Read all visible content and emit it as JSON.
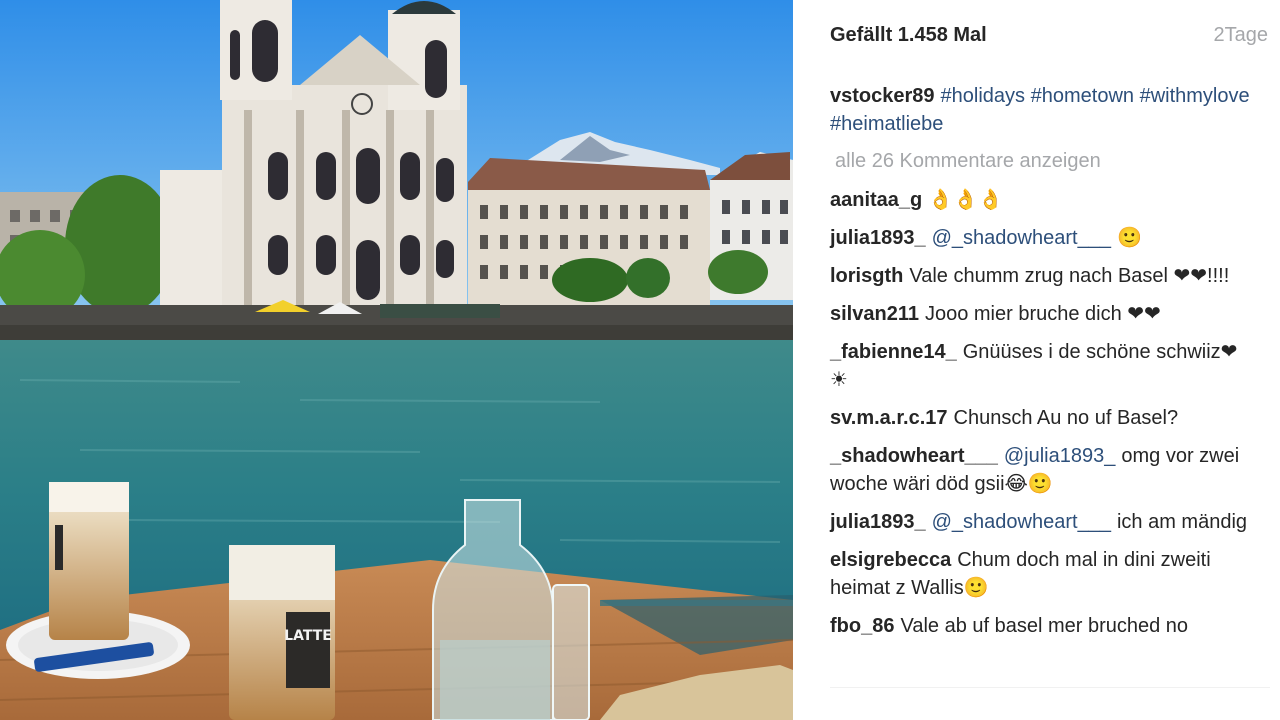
{
  "post": {
    "likes_text": "Gefällt 1.458 Mal",
    "age_text": "2Tage"
  },
  "caption": {
    "username": "vstocker89",
    "tags": [
      "#holidays",
      "#hometown",
      "#withmylove",
      "#heimatliebe"
    ]
  },
  "show_all_comments": "alle 26 Kommentare anzeigen",
  "comments": [
    {
      "user": "aanitaa_g",
      "mention": "",
      "text": "👌👌👌"
    },
    {
      "user": "julia1893_",
      "mention": "@_shadowheart___",
      "text": "🙂"
    },
    {
      "user": "lorisgth",
      "mention": "",
      "text": "Vale chumm zrug nach Basel ❤❤!!!!"
    },
    {
      "user": "silvan211",
      "mention": "",
      "text": "Jooo mier bruche dich ❤❤"
    },
    {
      "user": "_fabienne14_",
      "mention": "",
      "text": "Gnüüses i de schöne schwiiz❤☀"
    },
    {
      "user": "sv.m.a.r.c.17",
      "mention": "",
      "text": "Chunsch Au no uf Basel?"
    },
    {
      "user": "_shadowheart___",
      "mention": "@julia1893_",
      "text": "omg vor zwei woche wäri död gsii😂🙂"
    },
    {
      "user": "julia1893_",
      "mention": "@_shadowheart___",
      "text": "ich am mändig"
    },
    {
      "user": "elsigrebecca",
      "mention": "",
      "text": "Chum doch mal in dini zweiti heimat z Wallis🙂"
    },
    {
      "user": "fbo_86",
      "mention": "",
      "text": "Vale ab uf basel mer bruched no"
    }
  ],
  "photo": {
    "cup_label": "LATTE",
    "icon": "photo-image"
  },
  "colors": {
    "link": "#2d4f7a",
    "muted": "#a5a7aa",
    "text": "#262626"
  }
}
